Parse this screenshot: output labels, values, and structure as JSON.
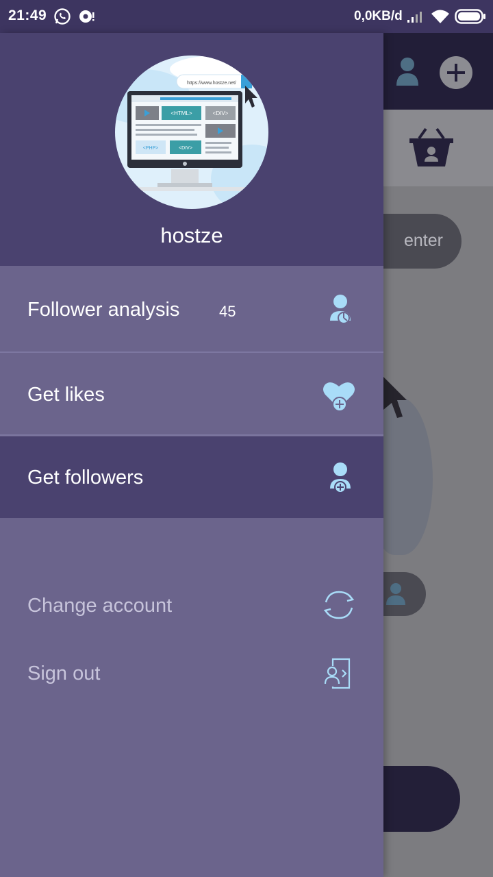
{
  "status_bar": {
    "time": "21:49",
    "network_speed": "0,0KB/d"
  },
  "background_app": {
    "enter_button_label": "enter"
  },
  "drawer": {
    "username": "hostze",
    "avatar_url_text": "https://www.hostze.net/",
    "avatar_tags": [
      "<HTML>",
      "<DIV>",
      "<PHP>",
      "<DIV>"
    ],
    "menu": [
      {
        "label": "Follower analysis",
        "count": "45",
        "icon": "user-chart-icon",
        "selected": false
      },
      {
        "label": "Get likes",
        "icon": "heart-plus-icon",
        "selected": false
      },
      {
        "label": "Get followers",
        "icon": "user-plus-icon",
        "selected": true
      }
    ],
    "actions": [
      {
        "label": "Change account",
        "icon": "refresh-icon"
      },
      {
        "label": "Sign out",
        "icon": "sign-out-icon"
      }
    ]
  },
  "colors": {
    "status_bar": "#3d3560",
    "drawer_header": "#4a426f",
    "drawer_body": "#6b648c",
    "selected_item": "#4a426f",
    "icon_accent": "#a9dcf8"
  }
}
